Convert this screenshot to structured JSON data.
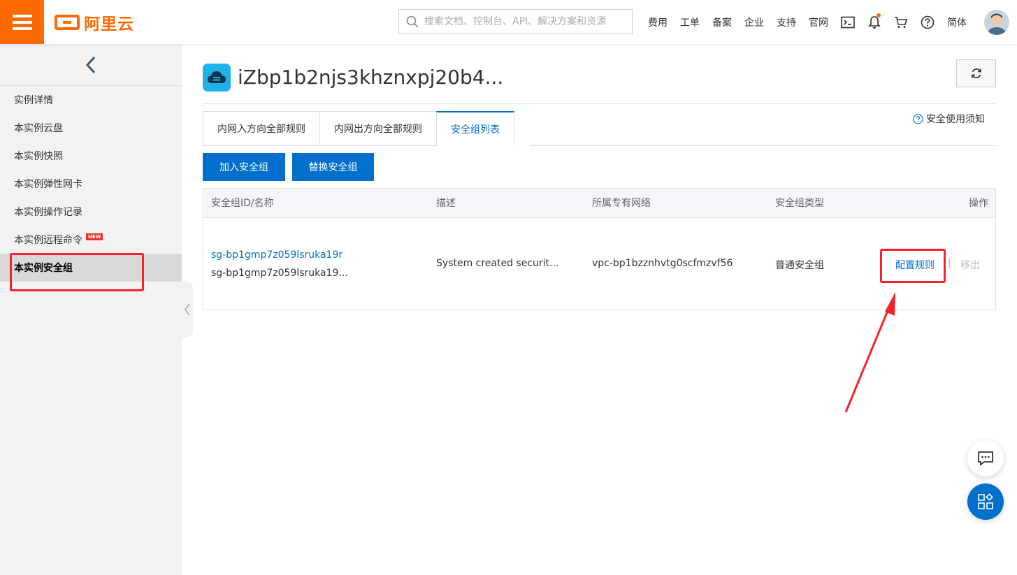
{
  "header": {
    "logo_text": "阿里云",
    "search_placeholder": "搜索文档、控制台、API、解决方案和资源",
    "nav": [
      "费用",
      "工单",
      "备案",
      "企业",
      "支持",
      "官网"
    ],
    "language": "简体",
    "brand_color": "#ff6a00"
  },
  "sidebar": {
    "items": [
      {
        "label": "实例详情"
      },
      {
        "label": "本实例云盘"
      },
      {
        "label": "本实例快照"
      },
      {
        "label": "本实例弹性网卡"
      },
      {
        "label": "本实例操作记录"
      },
      {
        "label": "本实例远程命令",
        "badge": "NEW"
      },
      {
        "label": "本实例安全组",
        "active": true
      }
    ]
  },
  "main": {
    "title": "iZbp1b2njs3khznxpj20b4...",
    "tabs": [
      "内网入方向全部规则",
      "内网出方向全部规则",
      "安全组列表"
    ],
    "active_tab": "安全组列表",
    "notice": "安全使用须知",
    "buttons": {
      "join": "加入安全组",
      "replace": "替换安全组"
    },
    "table": {
      "columns": [
        "安全组ID/名称",
        "描述",
        "所属专有网络",
        "安全组类型",
        "操作"
      ],
      "rows": [
        {
          "id": "sg-bp1gmp7z059lsruka19r",
          "name": "sg-bp1gmp7z059lsruka19...",
          "description": "System created securit...",
          "vpc": "vpc-bp1bzznhvtg0scfmzvf56",
          "type": "普通安全组",
          "action_configure": "配置规则",
          "action_remove": "移出"
        }
      ]
    },
    "accent_color": "#0070cc",
    "highlight_color": "#f5222d"
  }
}
